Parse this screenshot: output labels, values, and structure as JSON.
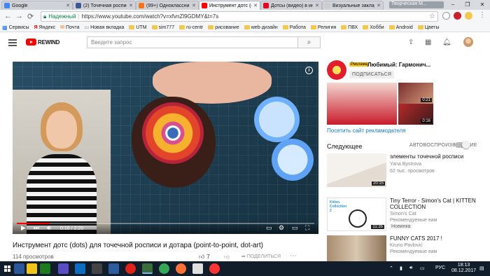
{
  "browser": {
    "tabs": [
      {
        "title": "Google",
        "color": "#4285f4",
        "active": false
      },
      {
        "title": "(2) Точечная роспис",
        "color": "#3b5998",
        "active": false
      },
      {
        "title": "(99+) Одноклассни",
        "color": "#f4731c",
        "active": false
      },
      {
        "title": "Инструмент дотс (d",
        "color": "#ff0000",
        "active": true
      },
      {
        "title": "Дотсы (видео) в инт",
        "color": "#e60023",
        "active": false
      },
      {
        "title": "Визуальные закладк",
        "color": "#cccccc",
        "active": false
      }
    ],
    "user_label": "Творческая М...",
    "window_controls": {
      "minimize": "–",
      "maximize": "❐",
      "close": "✕"
    },
    "nav": {
      "back": "←",
      "forward": "→",
      "reload": "⟳"
    },
    "secure_label": "Надежный",
    "url": "https://www.youtube.com/watch?v=xfvnZl9GDMY&t=7s",
    "bookmarks": [
      {
        "label": "Сервисы",
        "icon": "apps-icon"
      },
      {
        "label": "Яндекс",
        "icon": "yandex-icon"
      },
      {
        "label": "Почта",
        "icon": "mail-icon"
      },
      {
        "label": "Новая вкладка",
        "icon": "page-icon"
      },
      {
        "label": "UTM",
        "icon": "folder-icon"
      },
      {
        "label": "sim777",
        "icon": "folder-icon"
      },
      {
        "label": "ru-centr",
        "icon": "folder-icon"
      },
      {
        "label": "рисование",
        "icon": "folder-icon"
      },
      {
        "label": "web-дизайн",
        "icon": "folder-icon"
      },
      {
        "label": "Работа",
        "icon": "folder-icon"
      },
      {
        "label": "Религия",
        "icon": "folder-icon"
      },
      {
        "label": "ПВХ",
        "icon": "folder-icon"
      },
      {
        "label": "Хобби",
        "icon": "folder-icon"
      },
      {
        "label": "Android",
        "icon": "folder-icon"
      },
      {
        "label": "Цветы",
        "icon": "folder-icon"
      }
    ]
  },
  "youtube": {
    "logo_text": "REWIND",
    "search_placeholder": "Введите запрос",
    "player": {
      "time": "0:16 / 2:20",
      "progress": 0.11
    },
    "video_title": "Инструмент дотс (dots) для точечной росписи и дотара (point-to-point, dot-art)",
    "views": "114 просмотров",
    "likes": "7",
    "share_label": "ПОДЕЛИТЬСЯ",
    "ad": {
      "badge": "Реклама",
      "title": "Любимый: Гармонич...",
      "subscribe": "ПОДПИСАТЬСЯ",
      "durations": [
        "0:21",
        "0:16"
      ],
      "visit_link": "Посетить сайт рекламодателя"
    },
    "next_label": "Следующее",
    "autoplay_label": "АВТОВОСПРОИЗВЕДЕНИЕ",
    "recommendations": [
      {
        "title": "элементы точечной росписи",
        "channel": "Yana Bystrova",
        "meta": "62 тыс. просмотров",
        "duration": "20:15"
      },
      {
        "title": "Tiny Terror - Simon's Cat | KITTEN COLLECTION",
        "channel": "Simon's Cat",
        "meta": "Рекомендуемые вам",
        "badge": "Новинка",
        "duration": "11:35"
      },
      {
        "title": "FUNNY CATS 2017 !",
        "channel": "Kruno Pavlović",
        "meta": "Рекомендуемые вам",
        "duration": ""
      }
    ],
    "kitten_thumb_text": "Kitten Collection 2"
  },
  "taskbar": {
    "lang": "РУС",
    "time": "18:13",
    "date": "08.12.2017"
  }
}
